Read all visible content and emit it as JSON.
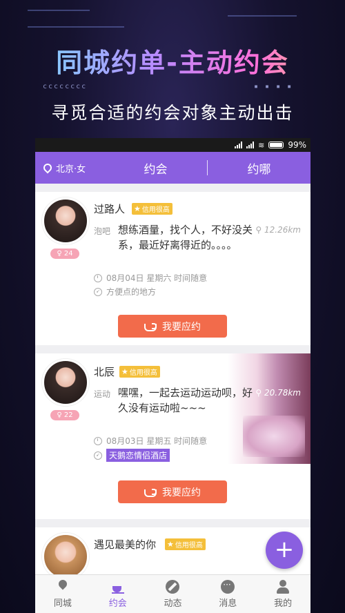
{
  "promo": {
    "title": "同城约单-主动约会",
    "subtitle": "寻觅合适的约会对象主动出击",
    "dots_left": "cccccccc",
    "dots_right": "▪ ▪ ▪ ▪"
  },
  "status_bar": {
    "battery": "99%"
  },
  "top_bar": {
    "location": "北京·女",
    "tabs": [
      "约会",
      "约哪"
    ]
  },
  "cards": [
    {
      "name": "过路人",
      "credit": "信用很高",
      "gender_age": "♀ 24",
      "category": "泡吧",
      "text": "想练酒量，找个人，不好没关系，最近好离得近的。。。。",
      "distance": "12.26km",
      "time": "08月04日 星期六 时间随意",
      "venue": "方便点的地方",
      "button": "我要应约"
    },
    {
      "name": "北辰",
      "credit": "信用很高",
      "gender_age": "♀ 22",
      "category": "运动",
      "text": "嘿嘿，一起去运动运动呗，好久没有运动啦~~~",
      "distance": "20.78km",
      "time": "08月03日 星期五 时间随意",
      "venue": "天鹅恋情侣酒店",
      "button": "我要应约"
    },
    {
      "name": "遇见最美的你",
      "credit": "信用很高"
    }
  ],
  "bottom_nav": [
    "同城",
    "约会",
    "动态",
    "消息",
    "我的"
  ],
  "colors": {
    "accent": "#8a5fe0",
    "button": "#f26b4b",
    "credit": "#f4bf3a"
  }
}
